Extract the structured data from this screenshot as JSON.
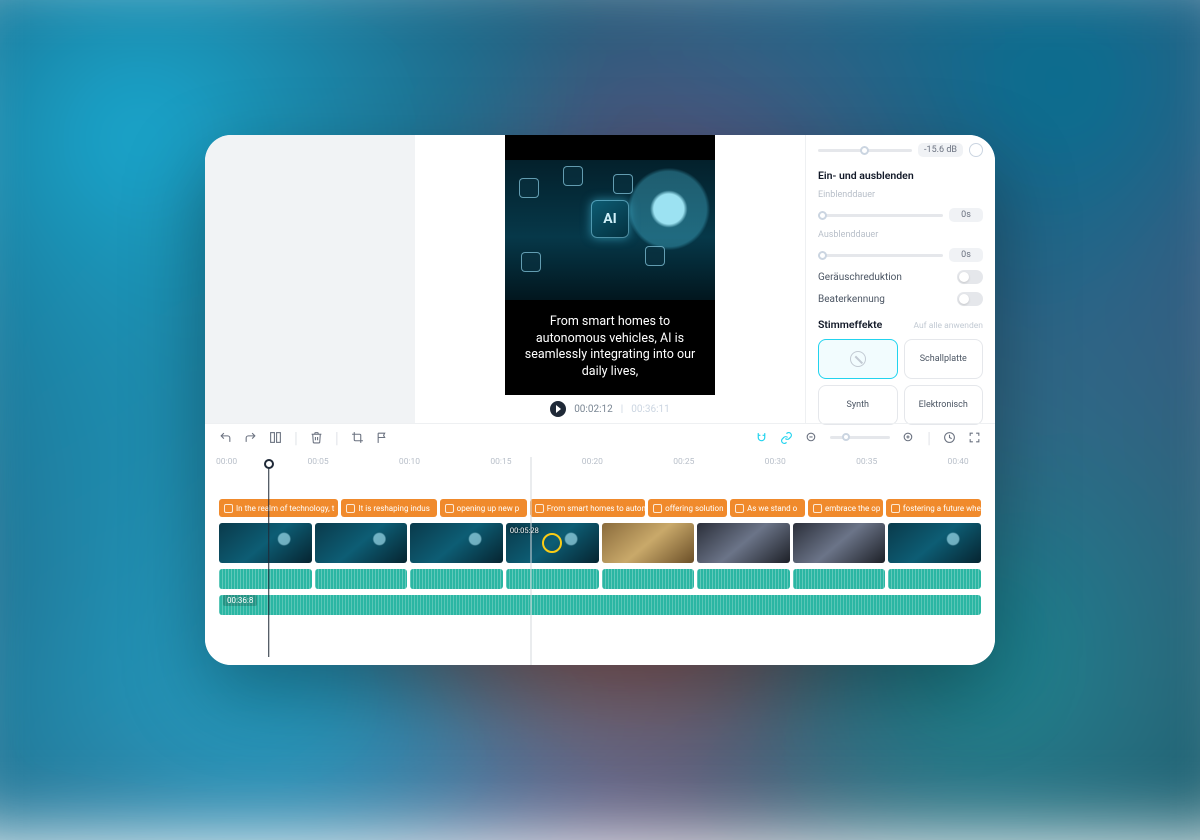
{
  "preview": {
    "chip_label": "AI",
    "subtitle": "From smart homes to autonomous vehicles, AI is seamlessly integrating into our daily lives,",
    "current_time": "00:02:12",
    "total_time": "00:36:11"
  },
  "panel": {
    "volume_value": "-15.6 dB",
    "fade_section": "Ein- und ausblenden",
    "fade_in_label": "Einblenddauer",
    "fade_in_value": "0s",
    "fade_out_label": "Ausblenddauer",
    "fade_out_value": "0s",
    "noise_reduction": "Geräuschreduktion",
    "beat_detect": "Beaterkennung",
    "voice_fx": "Stimmeffekte",
    "apply_all": "Auf alle anwenden",
    "fx": {
      "schallplatte": "Schallplatte",
      "synth": "Synth",
      "elektronisch": "Elektronisch"
    }
  },
  "ruler": {
    "t0": "00:00",
    "t1": "00:05",
    "t2": "00:10",
    "t3": "00:15",
    "t4": "00:20",
    "t5": "00:25",
    "t6": "00:30",
    "t7": "00:35",
    "t8": "00:40"
  },
  "captions": [
    "In the realm of technology, t",
    "It is reshaping indus",
    "opening up new p",
    "From smart homes to auton",
    "offering solution",
    "As we stand o",
    "embrace the op",
    "fostering a future whe"
  ],
  "clip_time": "00:05:28",
  "music_tag": "00:36:8"
}
